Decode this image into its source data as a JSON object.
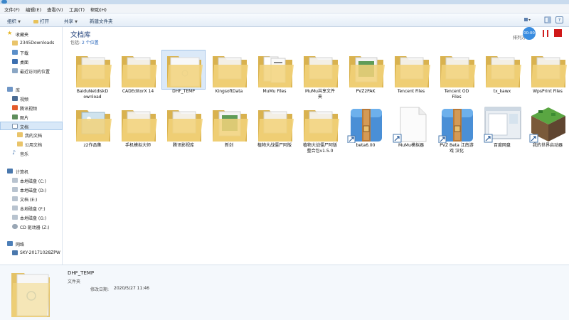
{
  "window": {
    "icon": "explorer-icon"
  },
  "menu": [
    "文件(F)",
    "编辑(E)",
    "查看(V)",
    "工具(T)",
    "帮助(H)"
  ],
  "toolbar": {
    "organize": "组织",
    "open": "打开",
    "share": "共享",
    "new_folder": "新建文件夹"
  },
  "sidebar": {
    "favorites": {
      "label": "收藏夹",
      "items": [
        "2345Downloads",
        "下载",
        "桌面",
        "最近访问的位置"
      ]
    },
    "libraries": {
      "label": "库",
      "items": [
        "视频",
        "腾讯视频",
        "图片",
        "文档",
        "我的文档",
        "公用文档",
        "音乐"
      ]
    },
    "computer": {
      "label": "计算机",
      "items": [
        "本地磁盘 (C:)",
        "本地磁盘 (D:)",
        "文档 (E:)",
        "本地磁盘 (F:)",
        "本地磁盘 (G:)",
        "CD 驱动器 (Z:)"
      ]
    },
    "network": {
      "label": "网络",
      "items": [
        "SKY-20171028ZPW"
      ]
    }
  },
  "main": {
    "title": "文档库",
    "subtitle_prefix": "包括:",
    "subtitle_link": "2 个位置",
    "arrange_label": "排列方"
  },
  "recorder": {
    "time": "00:00"
  },
  "files": [
    {
      "name": "BaiduNetdiskDownload",
      "icon": "folder-icon",
      "label": "BaiduNetdiskD\nownload"
    },
    {
      "name": "CADEditorX 14",
      "icon": "folder-icon",
      "label": "CADEditorX 14"
    },
    {
      "name": "DHF_TEMP",
      "icon": "folder-white-doc-icon",
      "label": "DHF_TEMP"
    },
    {
      "name": "KingsoftData",
      "icon": "folder-icon",
      "label": "KingsoftData"
    },
    {
      "name": "MuMu Files",
      "icon": "folder-docs-icon",
      "label": "MuMu Files"
    },
    {
      "name": "MuMu共享文件夹",
      "icon": "folder-icon",
      "label": "MuMu共享文件\n夹"
    },
    {
      "name": "PVZ2PAK",
      "icon": "folder-green-icon",
      "label": "PVZ2PAK"
    },
    {
      "name": "Tencent Files",
      "icon": "folder-icon",
      "label": "Tencent Files"
    },
    {
      "name": "Tencent OD Files",
      "icon": "folder-icon",
      "label": "Tencent OD\nFiles"
    },
    {
      "name": "tx_kawx",
      "icon": "folder-icon",
      "label": "tx_kawx"
    },
    {
      "name": "WpsPrint Files",
      "icon": "folder-icon",
      "label": "WpsPrint Files"
    },
    {
      "name": "z2作品集",
      "icon": "folder-image-icon",
      "label": "z2作品集"
    },
    {
      "name": "手机模拟大师",
      "icon": "folder-icon",
      "label": "手机模拟大师"
    },
    {
      "name": "腾讯影视库",
      "icon": "folder-icon",
      "label": "腾讯影视库"
    },
    {
      "name": "新剑",
      "icon": "folder-green-icon",
      "label": "新剑"
    },
    {
      "name": "植物大战僵尸阿版",
      "icon": "folder-icon",
      "label": "植物大战僵尸阿版"
    },
    {
      "name": "植物大战僵尸阿版整合包v1.5.0",
      "icon": "folder-icon",
      "label": "植物大战僵尸阿版\n整合包v1.5.0"
    },
    {
      "name": "beta6.00",
      "icon": "archive-icon",
      "label": "beta6.00"
    },
    {
      "name": "MuMu模拟器",
      "icon": "blank-shortcut-icon",
      "label": "MuMu模拟器"
    },
    {
      "name": "PVZ Beta 江南游戏 汉化",
      "icon": "archive-icon",
      "label": "PVZ Beta 江南游\n戏 汉化"
    },
    {
      "name": "百度网盘",
      "icon": "window-shortcut-icon",
      "label": "百度网盘"
    },
    {
      "name": "我的世界启动器",
      "icon": "minecraft-shortcut-icon",
      "label": "我的世界启动器"
    }
  ],
  "details": {
    "name": "DHF_TEMP",
    "type": "文件夹",
    "modified_label": "修改日期:",
    "modified_value": "2020/5/27 11:46"
  }
}
